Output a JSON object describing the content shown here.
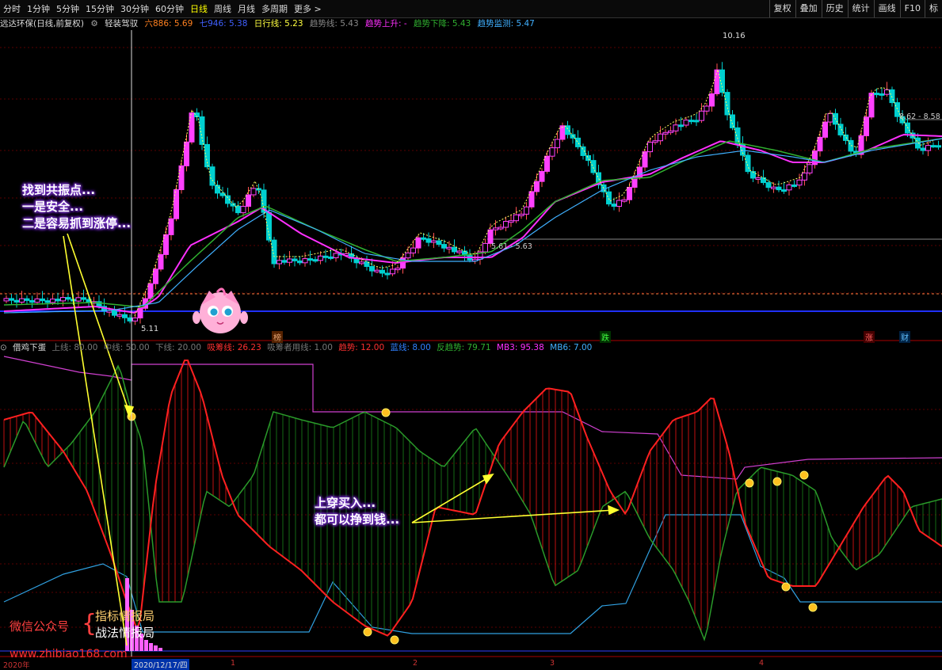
{
  "toolbar": {
    "periods": [
      "分时",
      "1分钟",
      "5分钟",
      "15分钟",
      "30分钟",
      "60分钟",
      "日线",
      "周线",
      "月线",
      "多周期",
      "更多"
    ],
    "active_period": "日线",
    "right_buttons": [
      "复权",
      "叠加",
      "历史",
      "统计",
      "画线",
      "F10",
      "标"
    ]
  },
  "main_info": {
    "stock_title": "远达环保(日线,前复权)",
    "strategy": "轻装驾驭",
    "ma6": "六886: 5.69",
    "ma7": "七946: 5.38",
    "daily_line": "日行线: 5.23",
    "trend_line": "趋势线: 5.43",
    "trend_up": "趋势上升: -",
    "trend_down": "趋势下降: 5.43",
    "trend_monitor": "趋势监测: 5.47"
  },
  "price_labels": {
    "high": "10.16",
    "low": "5.11",
    "range1": "5.61 - 5.63",
    "range2": "8.62 - 8.58"
  },
  "event_tags": [
    {
      "text": "榜",
      "color": "#e0a070",
      "bg": "#552200"
    },
    {
      "text": "跌",
      "color": "#40ff40",
      "bg": "#003300"
    },
    {
      "text": "涨",
      "color": "#ff6060",
      "bg": "#440000"
    },
    {
      "text": "财",
      "color": "#60c0ff",
      "bg": "#002244"
    }
  ],
  "sub_info": {
    "name": "借鸡下蛋",
    "upper": "上线: 80.00",
    "mid": "中线: 50.00",
    "lower": "下线: 20.00",
    "chip_line": "吸筹线: 26.23",
    "chip_cost": "吸筹者用线: 1.00",
    "trend": "趋势: 12.00",
    "blue": "蓝线: 8.00",
    "reverse": "反趋势: 79.71",
    "mb3": "MB3: 95.38",
    "mb6": "MB6: 7.00"
  },
  "callouts": {
    "resonance": [
      "找到共振点...",
      "一是安全...",
      "二是容易抓到涨停..."
    ],
    "buy": [
      "上穿买入...",
      "都可以挣到钱..."
    ]
  },
  "watermark": {
    "wechat": "微信公众号",
    "line1": "指标情报局",
    "line2": "战法情报局",
    "url": "www.zhibiao168.com"
  },
  "x_axis": {
    "year": "2020年",
    "cursor_date": "2020/12/17/四",
    "months": [
      "1",
      "2",
      "3",
      "4"
    ]
  },
  "colors": {
    "up": "#ff40ff",
    "down": "#00d0d0",
    "ma_magenta": "#ff30ff",
    "ma_green": "#30b030",
    "ma_cyan": "#40b0ff",
    "osc_red": "#ff2020",
    "osc_green": "#2a9a2a",
    "osc_magenta": "#d040d0",
    "osc_cyan": "#30a0e0"
  }
}
